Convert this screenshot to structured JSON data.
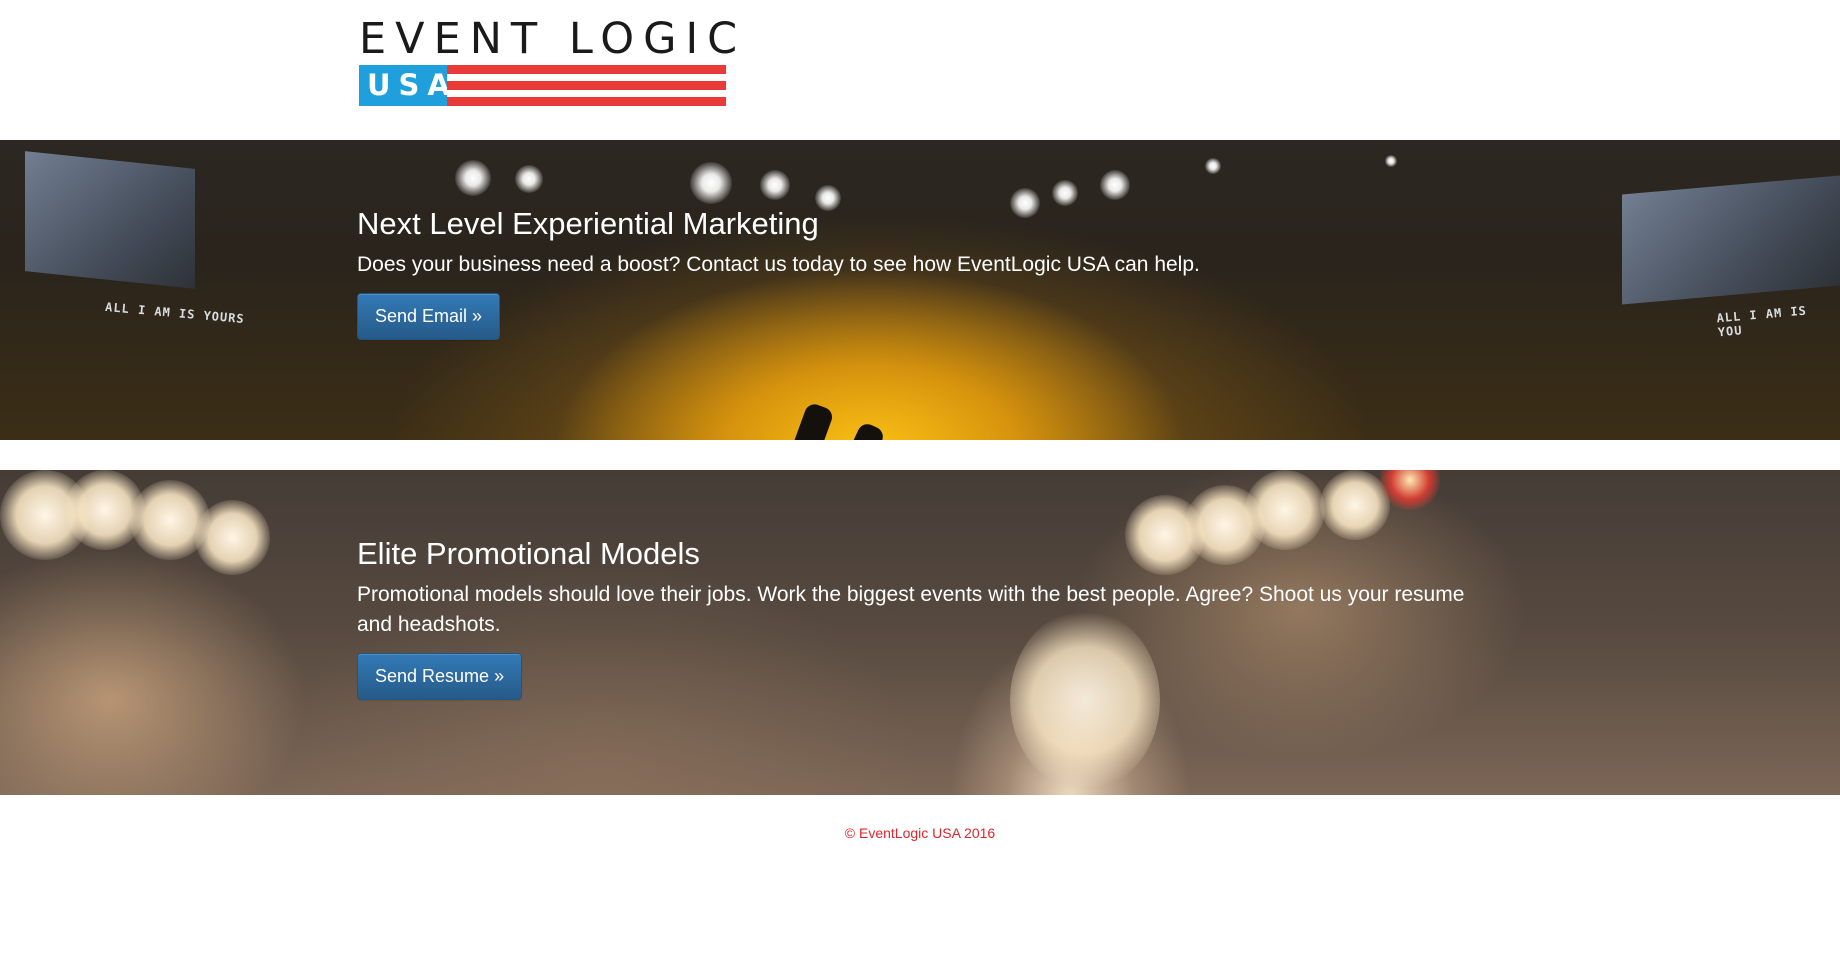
{
  "logo": {
    "wordmark": "EVENT LOGIC",
    "badge": "USA",
    "colors": {
      "blue": "#1fa0dd",
      "red": "#e83a36",
      "text": "#1a1a1a"
    }
  },
  "banners": [
    {
      "title": "Next Level Experiential Marketing",
      "text": "Does your business need a boost? Contact us today to see how EventLogic USA can help.",
      "button_label": "Send Email »",
      "screen_caption_left": "ALL I AM IS YOURS",
      "screen_caption_right": "ALL I AM IS YOU"
    },
    {
      "title": "Elite Promotional Models",
      "text": "Promotional models should love their jobs. Work the biggest events with the best people. Agree? Shoot us your resume and headshots.",
      "button_label": "Send Resume »"
    }
  ],
  "footer": {
    "copyright": "© EventLogic USA 2016",
    "color": "#e0242c"
  },
  "theme": {
    "button_color": "#2d6fa8"
  }
}
